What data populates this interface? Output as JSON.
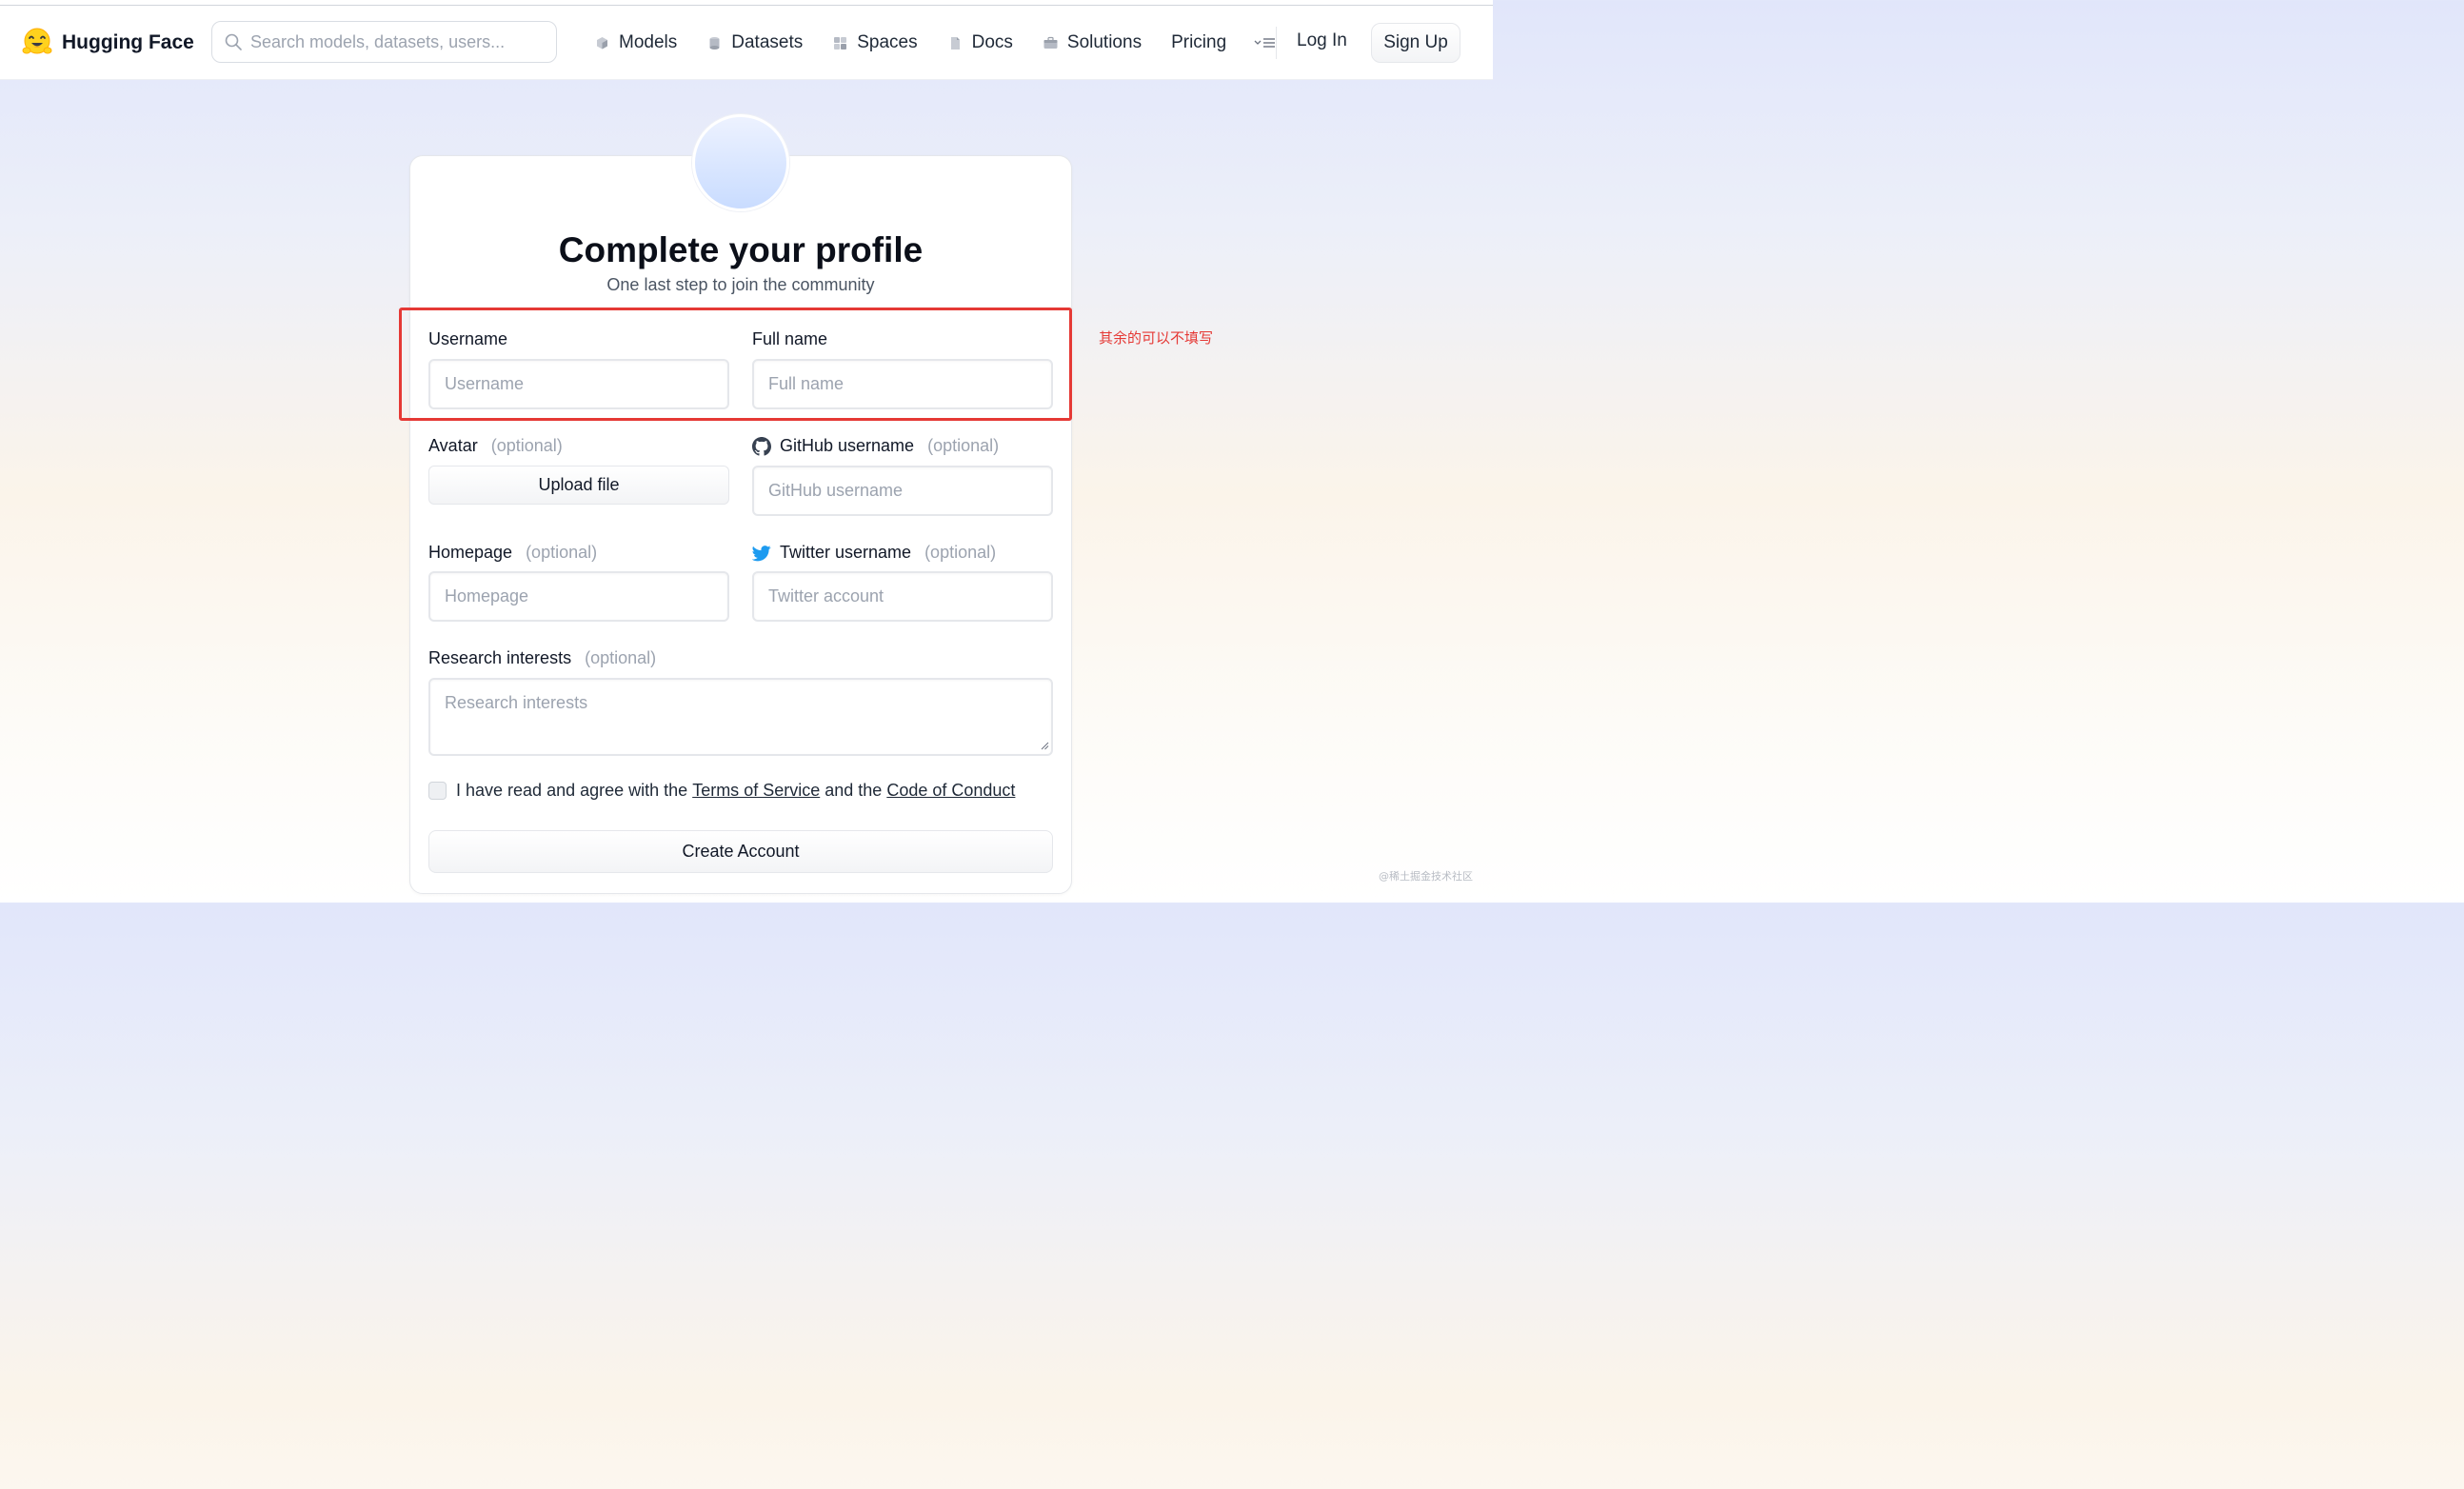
{
  "header": {
    "brand": "Hugging Face",
    "search_placeholder": "Search models, datasets, users...",
    "nav": [
      {
        "label": "Models",
        "icon": "cube-icon"
      },
      {
        "label": "Datasets",
        "icon": "database-icon"
      },
      {
        "label": "Spaces",
        "icon": "grid-icon"
      },
      {
        "label": "Docs",
        "icon": "document-icon"
      },
      {
        "label": "Solutions",
        "icon": "briefcase-icon"
      },
      {
        "label": "Pricing"
      }
    ],
    "login": "Log In",
    "signup": "Sign Up"
  },
  "form": {
    "title": "Complete your profile",
    "subtitle": "One last step to join the community",
    "optional_text": "(optional)",
    "username": {
      "label": "Username",
      "placeholder": "Username",
      "value": ""
    },
    "fullname": {
      "label": "Full name",
      "placeholder": "Full name",
      "value": ""
    },
    "avatar": {
      "label": "Avatar",
      "button": "Upload file"
    },
    "github": {
      "label": "GitHub username",
      "placeholder": "GitHub username"
    },
    "homepage": {
      "label": "Homepage",
      "placeholder": "Homepage"
    },
    "twitter": {
      "label": "Twitter username",
      "placeholder": "Twitter account"
    },
    "research": {
      "label": "Research interests",
      "placeholder": "Research interests"
    },
    "agree": {
      "prefix": "I have read and agree with the",
      "terms": "Terms of Service",
      "middle": "and the",
      "conduct": "Code of Conduct",
      "checked": false
    },
    "submit": "Create Account"
  },
  "annotation": {
    "text": "其余的可以不填写",
    "color": "#e53935"
  },
  "watermark": "@稀土掘金技术社区",
  "colors": {
    "accent_red": "#e53935",
    "twitter_blue": "#1d9bf0",
    "muted": "#9ca3af"
  }
}
